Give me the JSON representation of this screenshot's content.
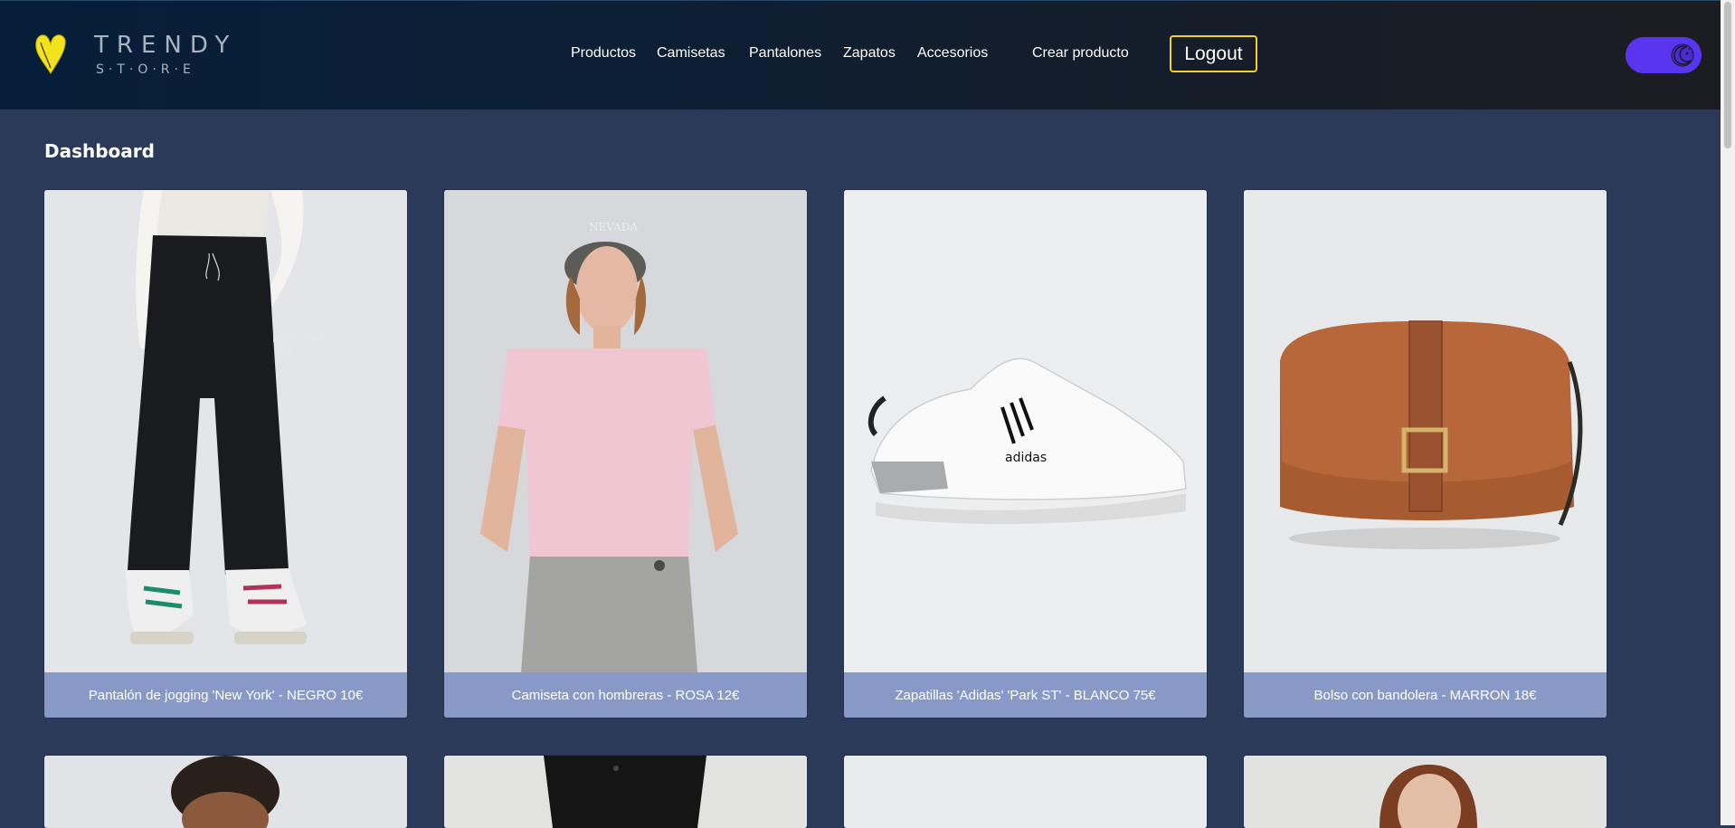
{
  "brand": {
    "name": "TRENDY",
    "sub": "S·T·O·R·E"
  },
  "nav": {
    "items": [
      "Productos",
      "Camisetas",
      "Pantalones",
      "Zapatos",
      "Accesorios"
    ],
    "create": "Crear producto",
    "logout": "Logout"
  },
  "page": {
    "title": "Dashboard"
  },
  "products": [
    {
      "caption": "Pantalón de jogging 'New York' - NEGRO 10€"
    },
    {
      "caption": "Camiseta con hombreras - ROSA 12€"
    },
    {
      "caption": "Zapatillas 'Adidas' 'Park ST' - BLANCO 75€"
    },
    {
      "caption": "Bolso con bandolera - MARRON 18€"
    }
  ],
  "colors": {
    "background": "#2c3a59",
    "caption_bg": "#8899c8",
    "logout_border": "#f2d22e",
    "toggle": "#5a35f0",
    "logo_heart": "#f4e21e"
  },
  "icons": {
    "logo": "heart-logo-icon",
    "toggle": "moon-icon"
  }
}
